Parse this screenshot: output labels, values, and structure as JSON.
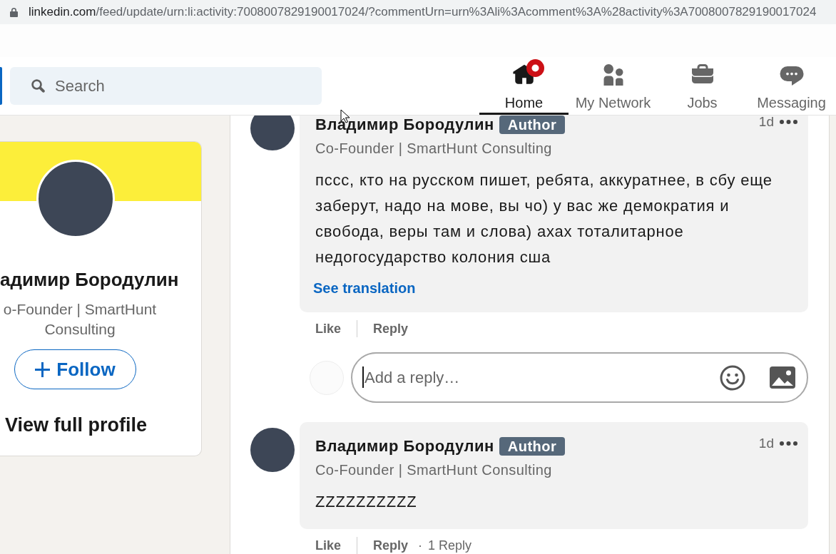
{
  "address_bar": {
    "host": "linkedin.com",
    "path": "/feed/update/urn:li:activity:7008007829190017024/?commentUrn=urn%3Ali%3Acomment%3A%28activity%3A7008007829190017024"
  },
  "header": {
    "search": {
      "placeholder": "Search"
    },
    "nav": [
      {
        "kind": "home",
        "label": "Home",
        "selected": true,
        "badge": true
      },
      {
        "kind": "network",
        "label": "My Network",
        "selected": false,
        "badge": false
      },
      {
        "kind": "jobs",
        "label": "Jobs",
        "selected": false,
        "badge": false
      },
      {
        "kind": "messaging",
        "label": "Messaging",
        "selected": false,
        "badge": false
      }
    ]
  },
  "profile_card": {
    "name": "адимир Бородулин",
    "headline": "o-Founder | SmartHunt Consulting",
    "follow_button": "Follow",
    "view_profile": "View full profile"
  },
  "comments": [
    {
      "author": "Владимир Бородулин",
      "badge": "Author",
      "headline": "Co-Founder | SmartHunt Consulting",
      "time": "1d",
      "text": "пссс, кто на русском пишет, ребята, аккуратнее, в сбу еще заберут, надо на мове, вы чо) у вас же демократия и свобода, веры там и слова) ахах тоталитарное недогосударство колония сша",
      "see_translation": "See translation",
      "actions": [
        "Like",
        "Reply"
      ],
      "reply_box": {
        "placeholder": "Add a reply…"
      }
    },
    {
      "author": "Владимир Бородулин",
      "badge": "Author",
      "headline": "Co-Founder | SmartHunt Consulting",
      "time": "1d",
      "text": "ZZZZZZZZZZ",
      "actions": [
        "Like",
        "Reply"
      ],
      "replies": {
        "separator": "·",
        "label": "1 Reply"
      }
    }
  ]
}
